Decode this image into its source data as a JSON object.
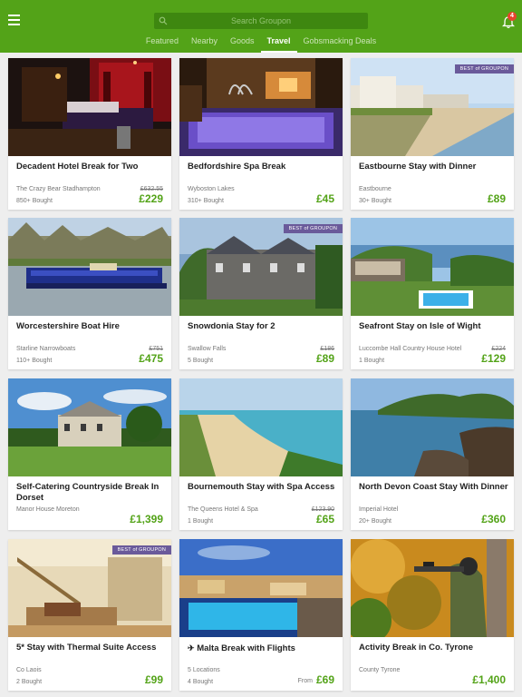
{
  "header": {
    "search_placeholder": "Search Groupon",
    "notification_count": "4",
    "tabs": [
      "Featured",
      "Nearby",
      "Goods",
      "Travel",
      "Gobsmacking Deals"
    ],
    "active_tab": "Travel",
    "accent": "#53a318"
  },
  "ribbon_text": "BEST of GROUPON",
  "deals": [
    {
      "title": "Decadent Hotel Break for Two",
      "merchant": "The Crazy Bear Stadhampton",
      "bought": "850+ Bought",
      "old_price": "£632.55",
      "price": "£229"
    },
    {
      "title": "Bedfordshire Spa Break",
      "merchant": "Wyboston Lakes",
      "bought": "310+ Bought",
      "old_price": "",
      "price": "£45"
    },
    {
      "title": "Eastbourne Stay with Dinner",
      "merchant": "Eastbourne",
      "bought": "30+ Bought",
      "old_price": "",
      "price": "£89",
      "ribbon": true
    },
    {
      "title": "Worcestershire Boat Hire",
      "merchant": "Starline Narrowboats",
      "bought": "110+ Bought",
      "old_price": "£751",
      "price": "£475"
    },
    {
      "title": "Snowdonia Stay for 2",
      "merchant": "Swallow Falls",
      "bought": "5 Bought",
      "old_price": "£186",
      "price": "£89",
      "ribbon": true
    },
    {
      "title": "Seafront Stay on Isle of Wight",
      "merchant": "Luccombe Hall Country House Hotel",
      "bought": "1 Bought",
      "old_price": "£224",
      "price": "£129"
    },
    {
      "title": "Self-Catering Countryside Break In Dorset",
      "merchant": "Manor House Moreton",
      "bought": "",
      "old_price": "",
      "price": "£1,399"
    },
    {
      "title": "Bournemouth Stay with Spa Access",
      "merchant": "The Queens Hotel & Spa",
      "bought": "1 Bought",
      "old_price": "£123.90",
      "price": "£65"
    },
    {
      "title": "North Devon Coast Stay With Dinner",
      "merchant": "Imperial Hotel",
      "bought": "20+ Bought",
      "old_price": "",
      "price": "£360"
    },
    {
      "title": "5* Stay with Thermal Suite Access",
      "merchant": "Co Laois",
      "bought": "2 Bought",
      "old_price": "",
      "price": "£99",
      "ribbon": true
    },
    {
      "title": "Malta Break with Flights",
      "merchant": "5 Locations",
      "bought": "4 Bought",
      "old_price": "",
      "price": "£69",
      "from": "From",
      "icon": "airplane-icon"
    },
    {
      "title": "Activity Break in Co. Tyrone",
      "merchant": "County Tyrone",
      "bought": "",
      "old_price": "",
      "price": "£1,400"
    }
  ]
}
